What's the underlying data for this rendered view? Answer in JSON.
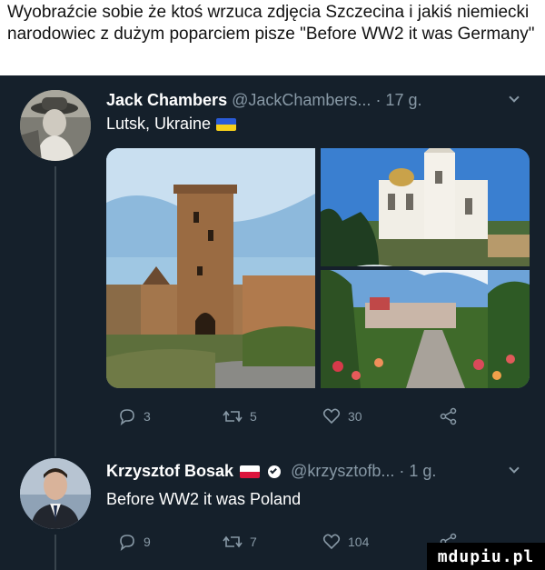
{
  "caption": {
    "text": "Wyobraźcie sobie że ktoś wrzuca zdjęcia Szczecina i jakiś niemiecki narodowiec z dużym poparciem pisze \"Before WW2 it was Germany\""
  },
  "tweet1": {
    "name": "Jack Chambers",
    "handle": "@JackChambers...",
    "time": "· 17 g.",
    "text": "Lutsk, Ukraine",
    "flag_colors": [
      "#2a5bd7",
      "#f6d01b"
    ],
    "replies": "3",
    "retweets": "5",
    "likes": "30"
  },
  "tweet2": {
    "name": "Krzysztof Bosak",
    "handle": "@krzysztofb...",
    "time": "· 1 g.",
    "text": "Before WW2 it was Poland",
    "flag_colors": [
      "#ffffff",
      "#dc143c"
    ],
    "replies": "9",
    "retweets": "7",
    "likes": "104"
  },
  "watermark": "mdupiu.pl",
  "colors": {
    "background": "#15202b",
    "secondary_text": "#8899a6",
    "thread_line": "#38444d"
  }
}
